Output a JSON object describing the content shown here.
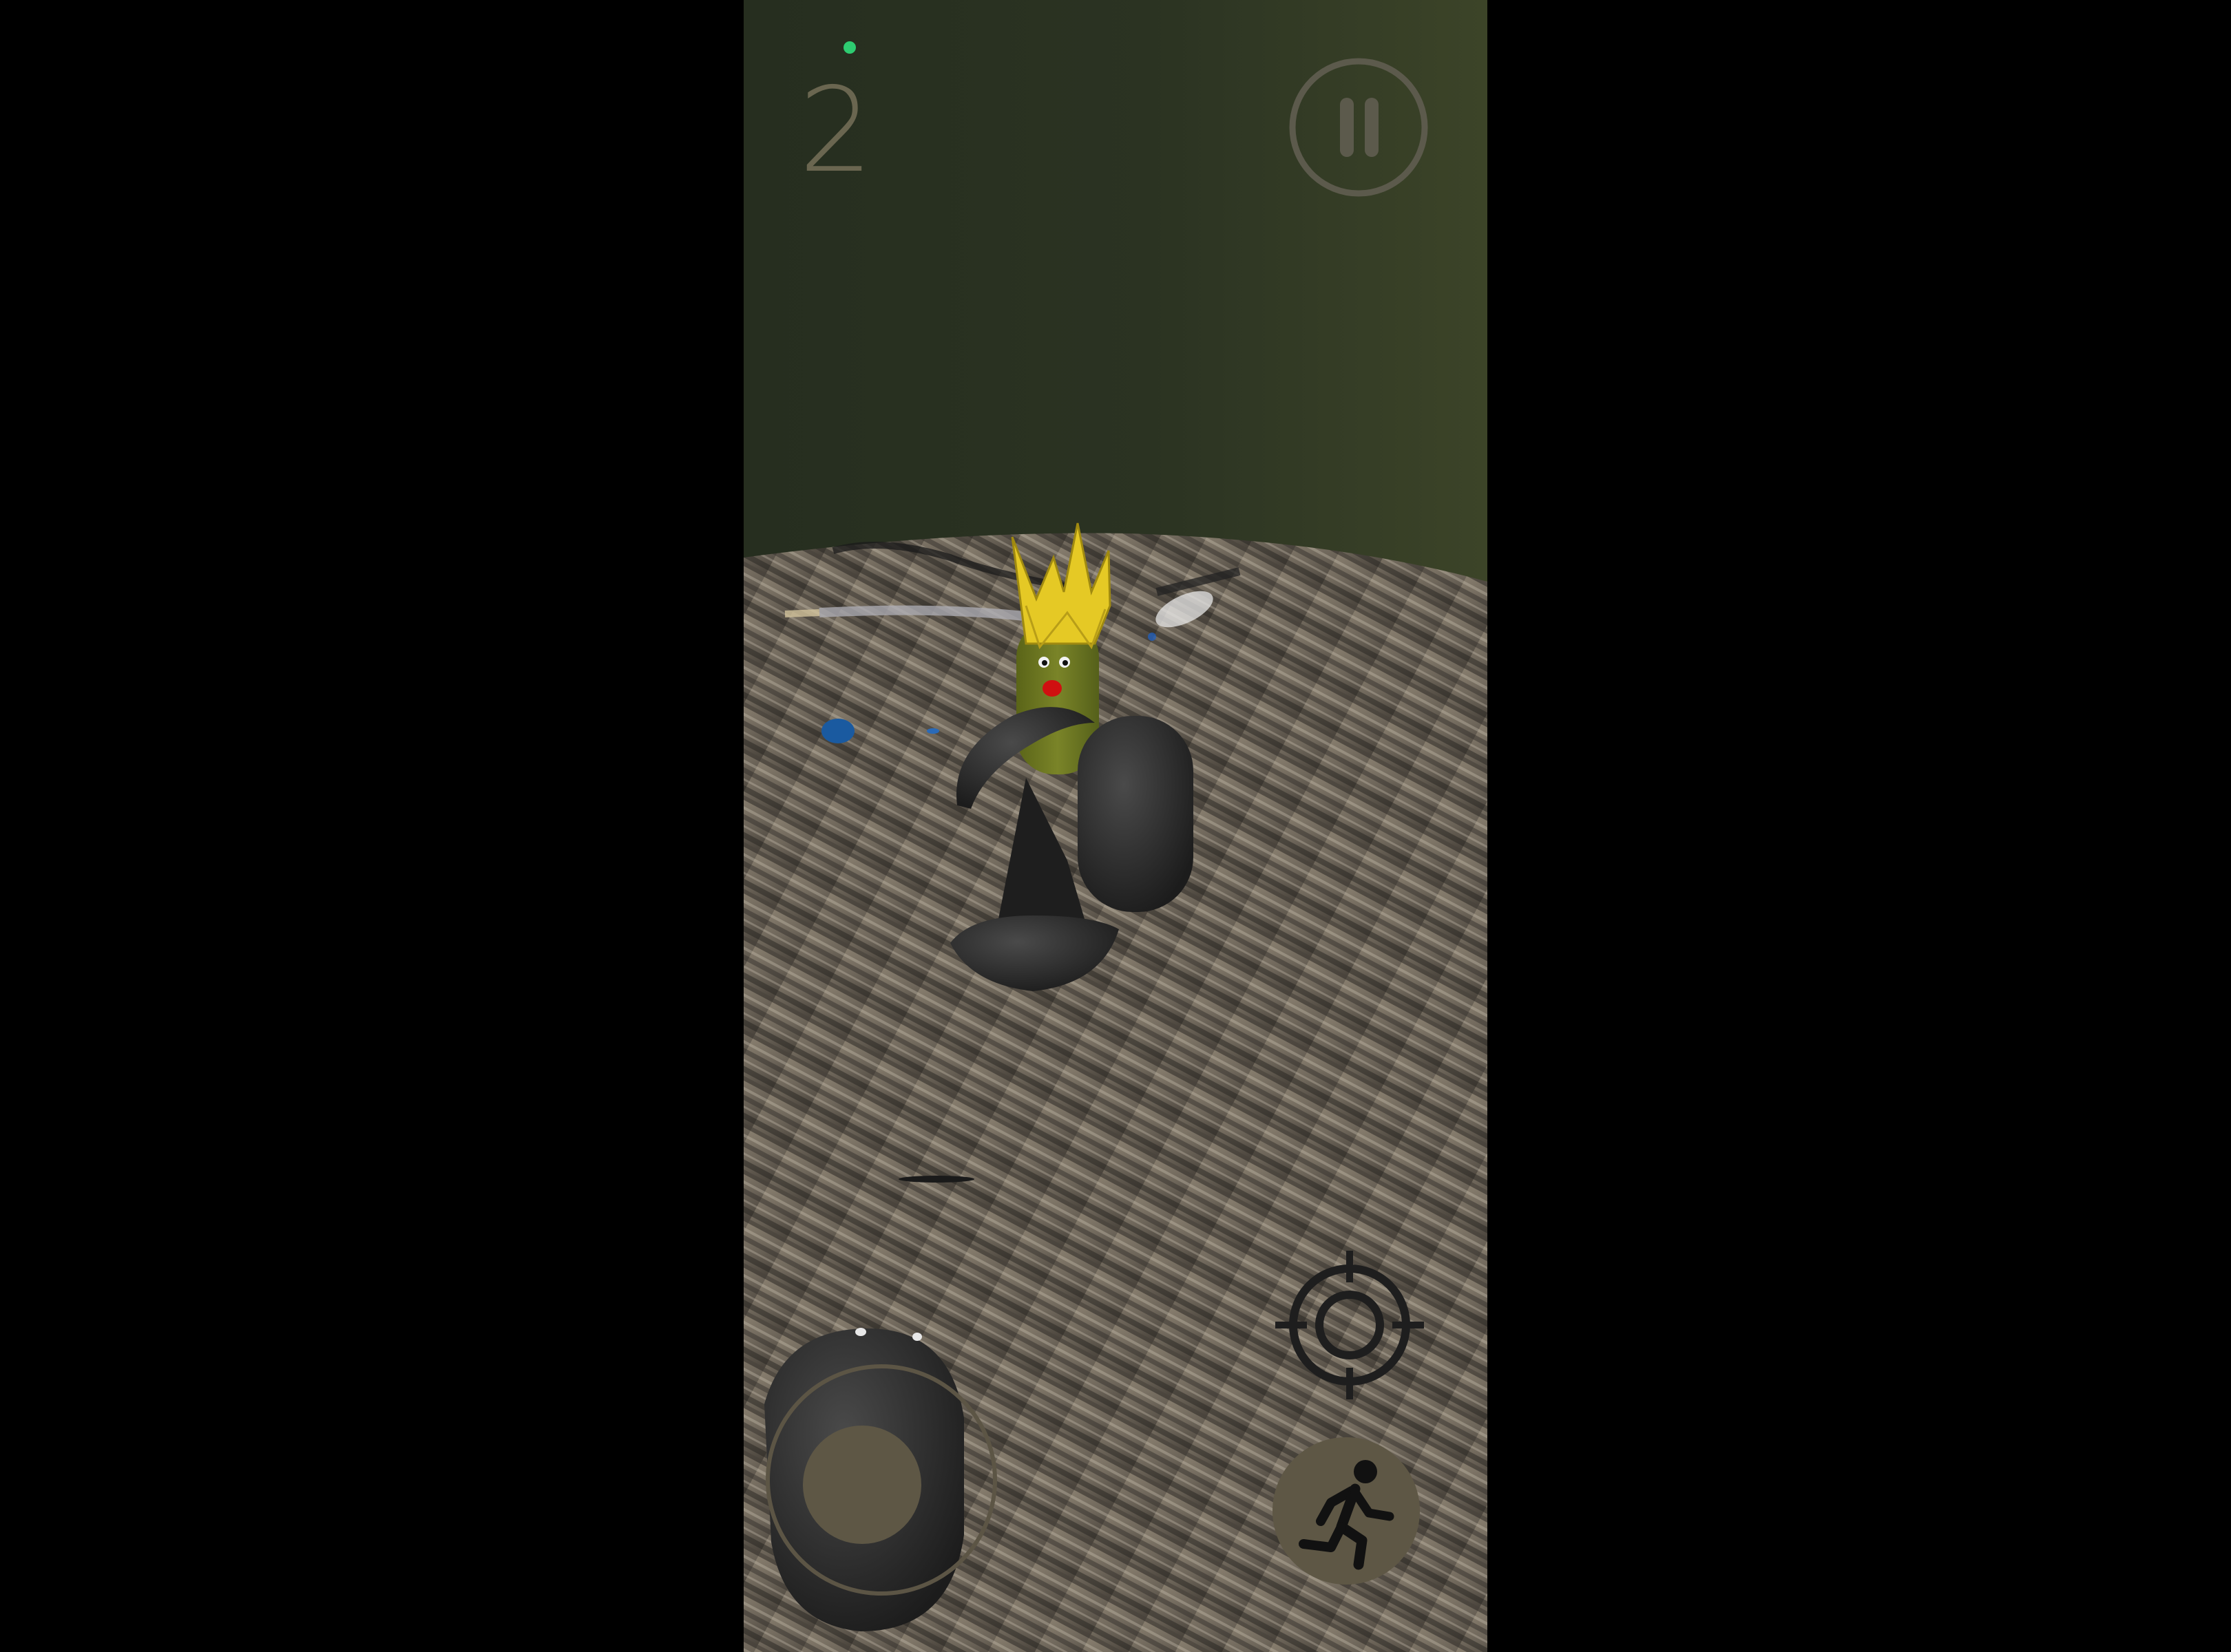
{
  "hud": {
    "score": "2",
    "status_indicator_color": "#2ecc71"
  },
  "controls": {
    "pause_icon": "pause-icon",
    "aim_icon": "crosshair-icon",
    "run_icon": "running-person-icon",
    "joystick_icon": "virtual-joystick"
  },
  "scene": {
    "background_wall_color": "#2b3322",
    "floor_texture": "striped-wood-desk",
    "character_crown_color": "#e0c020",
    "character_body_color": "#6f7a22",
    "nose_color": "#d01010"
  }
}
